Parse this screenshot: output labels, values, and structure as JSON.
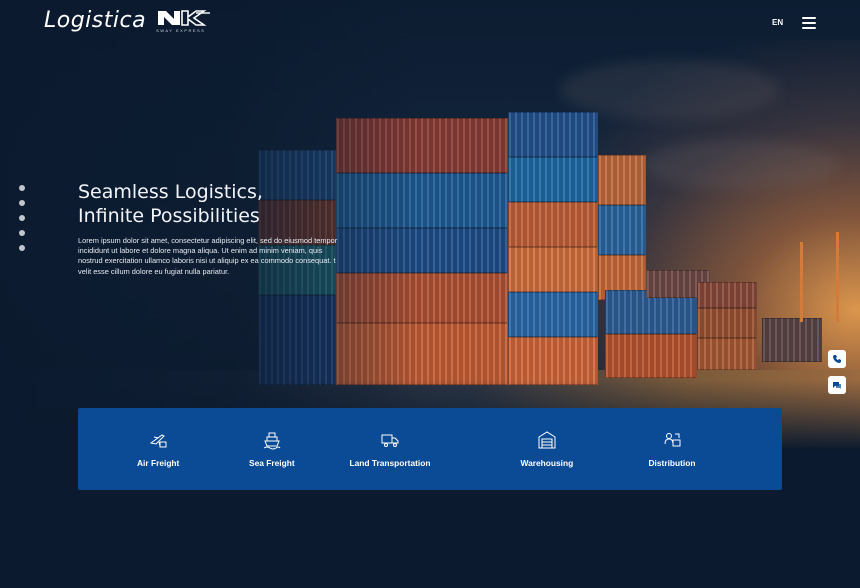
{
  "header": {
    "logo_text": "Logistica",
    "logo_tagline": "SWAY EXPRESS",
    "language": "EN",
    "menu_icon": "hamburger-menu-icon"
  },
  "social_icons": [
    "instagram-icon",
    "facebook-icon",
    "twitter-icon",
    "linkedin-icon",
    "youtube-icon"
  ],
  "hero": {
    "headline_line1": "Seamless Logistics,",
    "headline_line2": "Infinite Possibilities",
    "body": "Lorem ipsum dolor sit amet, consectetur adipiscing elit, sed do eiusmod tempor incididunt ut labore et dolore magna aliqua. Ut enim ad minim veniam, quis nostrud exercitation ullamco laboris nisi ut aliquip ex ea commodo consequat. t velit esse cillum dolore eu fugiat nulla pariatur."
  },
  "floating_buttons": [
    "phone-icon",
    "chat-icon"
  ],
  "services": [
    {
      "label": "Air Freight",
      "icon": "air-freight-icon"
    },
    {
      "label": "Sea Freight",
      "icon": "sea-freight-icon"
    },
    {
      "label": "Land Transportation",
      "icon": "truck-icon"
    },
    {
      "label": "Warehousing",
      "icon": "warehouse-icon"
    },
    {
      "label": "Distribution",
      "icon": "distribution-icon"
    }
  ],
  "colors": {
    "page_background": "#0b1a2e",
    "services_bar": "#0b4a95",
    "sunset_accent": "#d47a3a"
  }
}
